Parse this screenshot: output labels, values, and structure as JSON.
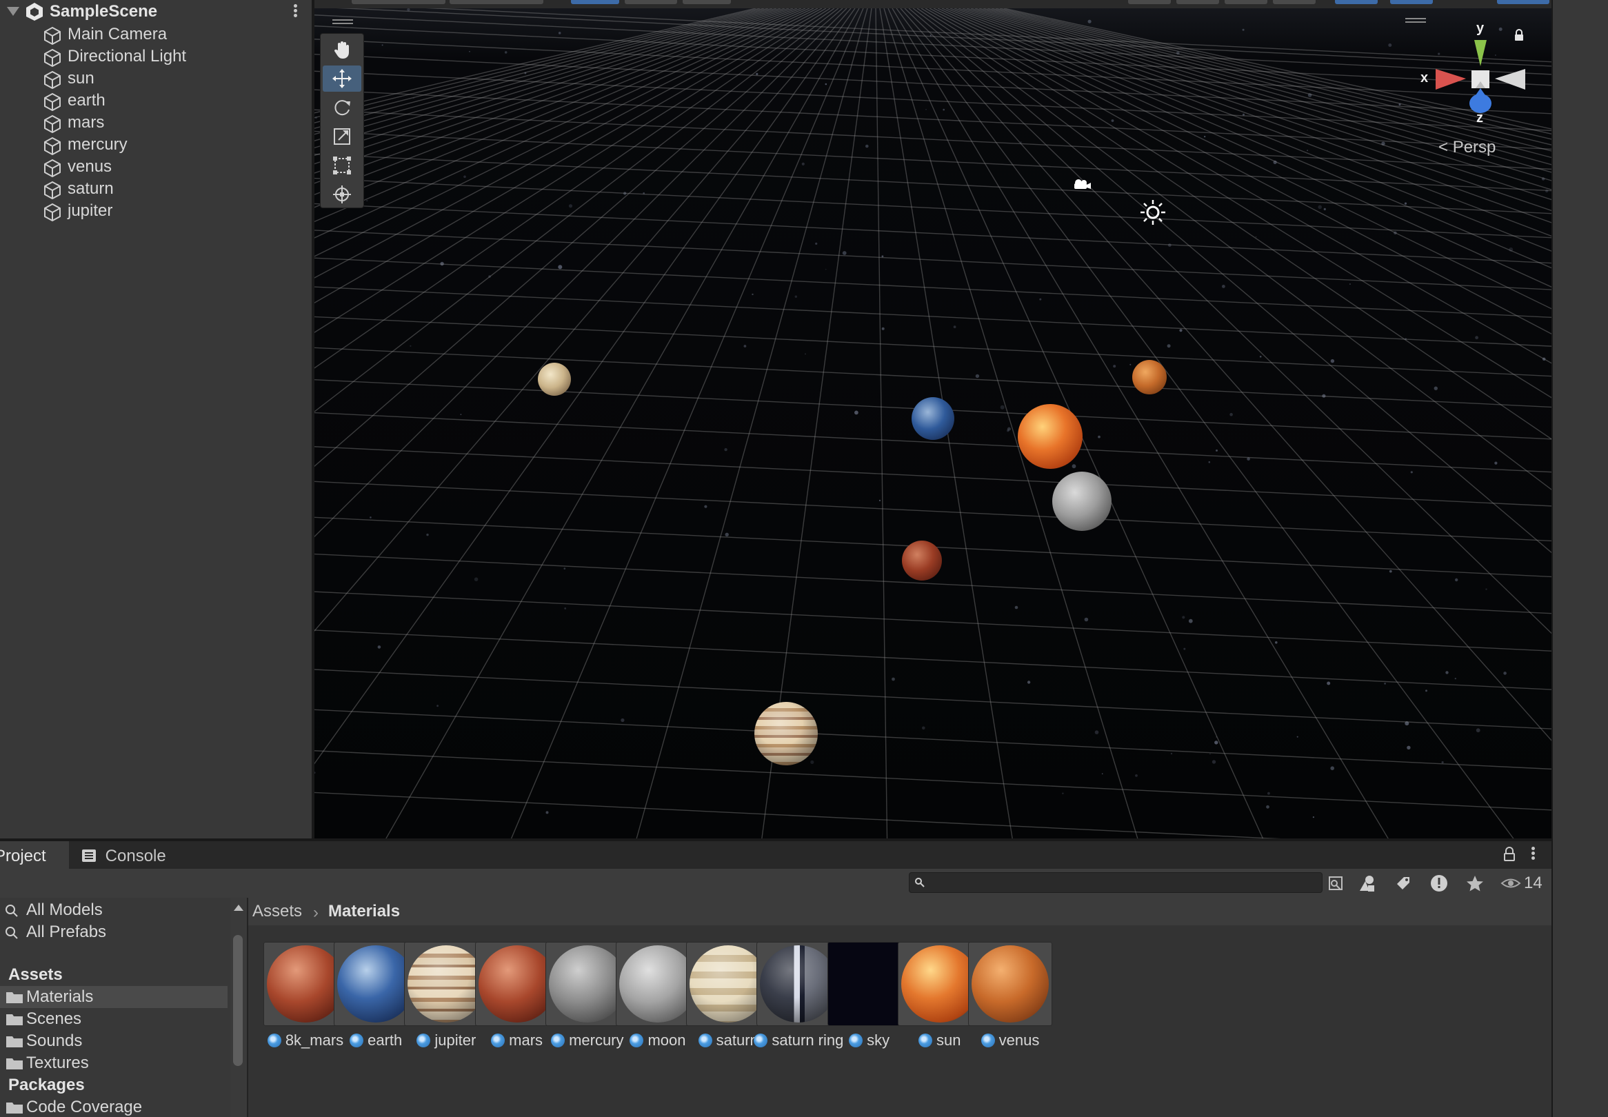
{
  "hierarchy": {
    "scene_name": "SampleScene",
    "items": [
      {
        "label": "Main Camera"
      },
      {
        "label": "Directional Light"
      },
      {
        "label": "sun"
      },
      {
        "label": "earth"
      },
      {
        "label": "mars"
      },
      {
        "label": "mercury"
      },
      {
        "label": "venus"
      },
      {
        "label": "saturn"
      },
      {
        "label": "jupiter"
      }
    ]
  },
  "scene_view": {
    "tools": [
      "hand-tool",
      "move-tool",
      "rotate-tool",
      "scale-tool",
      "rect-tool",
      "transform-tool"
    ],
    "active_tool": "move-tool",
    "gizmo": {
      "x": "x",
      "y": "y",
      "z": "z"
    },
    "projection_label": "Persp",
    "colors": {
      "x_axis": "#d9534f",
      "y_axis": "#8bc34a",
      "z_axis": "#3d7be0",
      "selection": "#46607c"
    }
  },
  "bottom_panel": {
    "tabs": [
      {
        "label": "Project",
        "active": true
      },
      {
        "label": "Console",
        "active": false
      }
    ],
    "search": {
      "value": "",
      "placeholder": ""
    },
    "visible_count": "14",
    "favorites": [
      {
        "label": "All Models"
      },
      {
        "label": "All Prefabs"
      }
    ],
    "tree": {
      "assets_label": "Assets",
      "asset_folders": [
        {
          "label": "Materials",
          "selected": true
        },
        {
          "label": "Scenes",
          "selected": false
        },
        {
          "label": "Sounds",
          "selected": false
        },
        {
          "label": "Textures",
          "selected": false
        }
      ],
      "packages_label": "Packages",
      "package_folders": [
        {
          "label": "Code Coverage"
        }
      ]
    },
    "breadcrumb": {
      "root": "Assets",
      "current": "Materials"
    },
    "materials": [
      {
        "name": "8k_mars"
      },
      {
        "name": "earth"
      },
      {
        "name": "jupiter"
      },
      {
        "name": "mars"
      },
      {
        "name": "mercury"
      },
      {
        "name": "moon"
      },
      {
        "name": "saturn"
      },
      {
        "name": "saturn ring"
      },
      {
        "name": "sky"
      },
      {
        "name": "sun"
      },
      {
        "name": "venus"
      }
    ]
  }
}
